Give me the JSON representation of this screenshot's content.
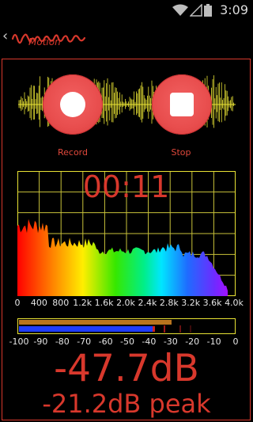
{
  "status_bar": {
    "time": "3:09"
  },
  "header": {
    "app_logo_text": "Motion"
  },
  "buttons": {
    "record_label": "Record",
    "stop_label": "Stop"
  },
  "timer": {
    "value": "00:11"
  },
  "spectrum": {
    "freq_axis_labels": [
      "0",
      "400",
      "800",
      "1.2k",
      "1.6k",
      "2.0k",
      "2.4k",
      "2.8k",
      "3.2k",
      "3.6k",
      "4.0k"
    ]
  },
  "meter": {
    "db_axis_labels": [
      "-100",
      "-90",
      "-80",
      "-70",
      "-60",
      "-50",
      "-40",
      "-30",
      "-20",
      "-10",
      "0"
    ],
    "level_db": -47.7,
    "peak_db": -21.2
  },
  "readout": {
    "level_text": "-47.7dB",
    "peak_text": "-21.2dB peak"
  },
  "colors": {
    "accent": "#d8382c",
    "grid": "#e8e234",
    "button": "#e84d4d"
  }
}
